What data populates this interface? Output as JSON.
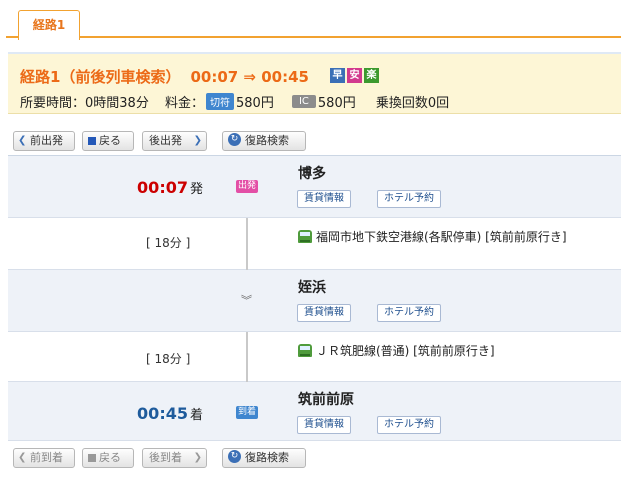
{
  "tab": {
    "label": "経路1"
  },
  "summary": {
    "title": "経路1（前後列車検索）",
    "time_range": "00:07 ⇒ 00:45",
    "badges": [
      "早",
      "安",
      "楽"
    ],
    "duration_label": "所要時間：",
    "duration": "0時間38分",
    "fare_label": "料金：",
    "ticket_tag": "切符",
    "ticket_fare": "580円",
    "ic_tag": "IC",
    "ic_fare": "580円",
    "transfer_label": "乗換回数",
    "transfers": "0回"
  },
  "nav_top": {
    "prev": "前出発",
    "back": "戻る",
    "next": "後出発",
    "reverse": "復路検索"
  },
  "nav_bottom": {
    "prev": "前到着",
    "back": "戻る",
    "next": "後到着",
    "reverse": "復路検索"
  },
  "stations": [
    {
      "name": "博多",
      "time": "00:07",
      "time_suffix": "発",
      "mark": "出発",
      "fare_btn": "賃貸情報",
      "hotel_btn": "ホテル予約"
    },
    {
      "name": "姪浜",
      "time": "",
      "time_suffix": "",
      "mark": "",
      "fare_btn": "賃貸情報",
      "hotel_btn": "ホテル予約"
    },
    {
      "name": "筑前前原",
      "time": "00:45",
      "time_suffix": "着",
      "mark": "到着",
      "fare_btn": "賃貸情報",
      "hotel_btn": "ホテル予約"
    }
  ],
  "segments": [
    {
      "duration": "[ 18分 ]",
      "line": "福岡市地下鉄空港線(各駅停車) [筑前前原行き]"
    },
    {
      "duration": "[ 18分 ]",
      "line": "ＪＲ筑肥線(普通) [筑前前原行き]"
    }
  ],
  "colors": {
    "accent_orange": "#ec6a17",
    "dep_time": "#cc0000",
    "arr_time": "#1e5b9c"
  }
}
